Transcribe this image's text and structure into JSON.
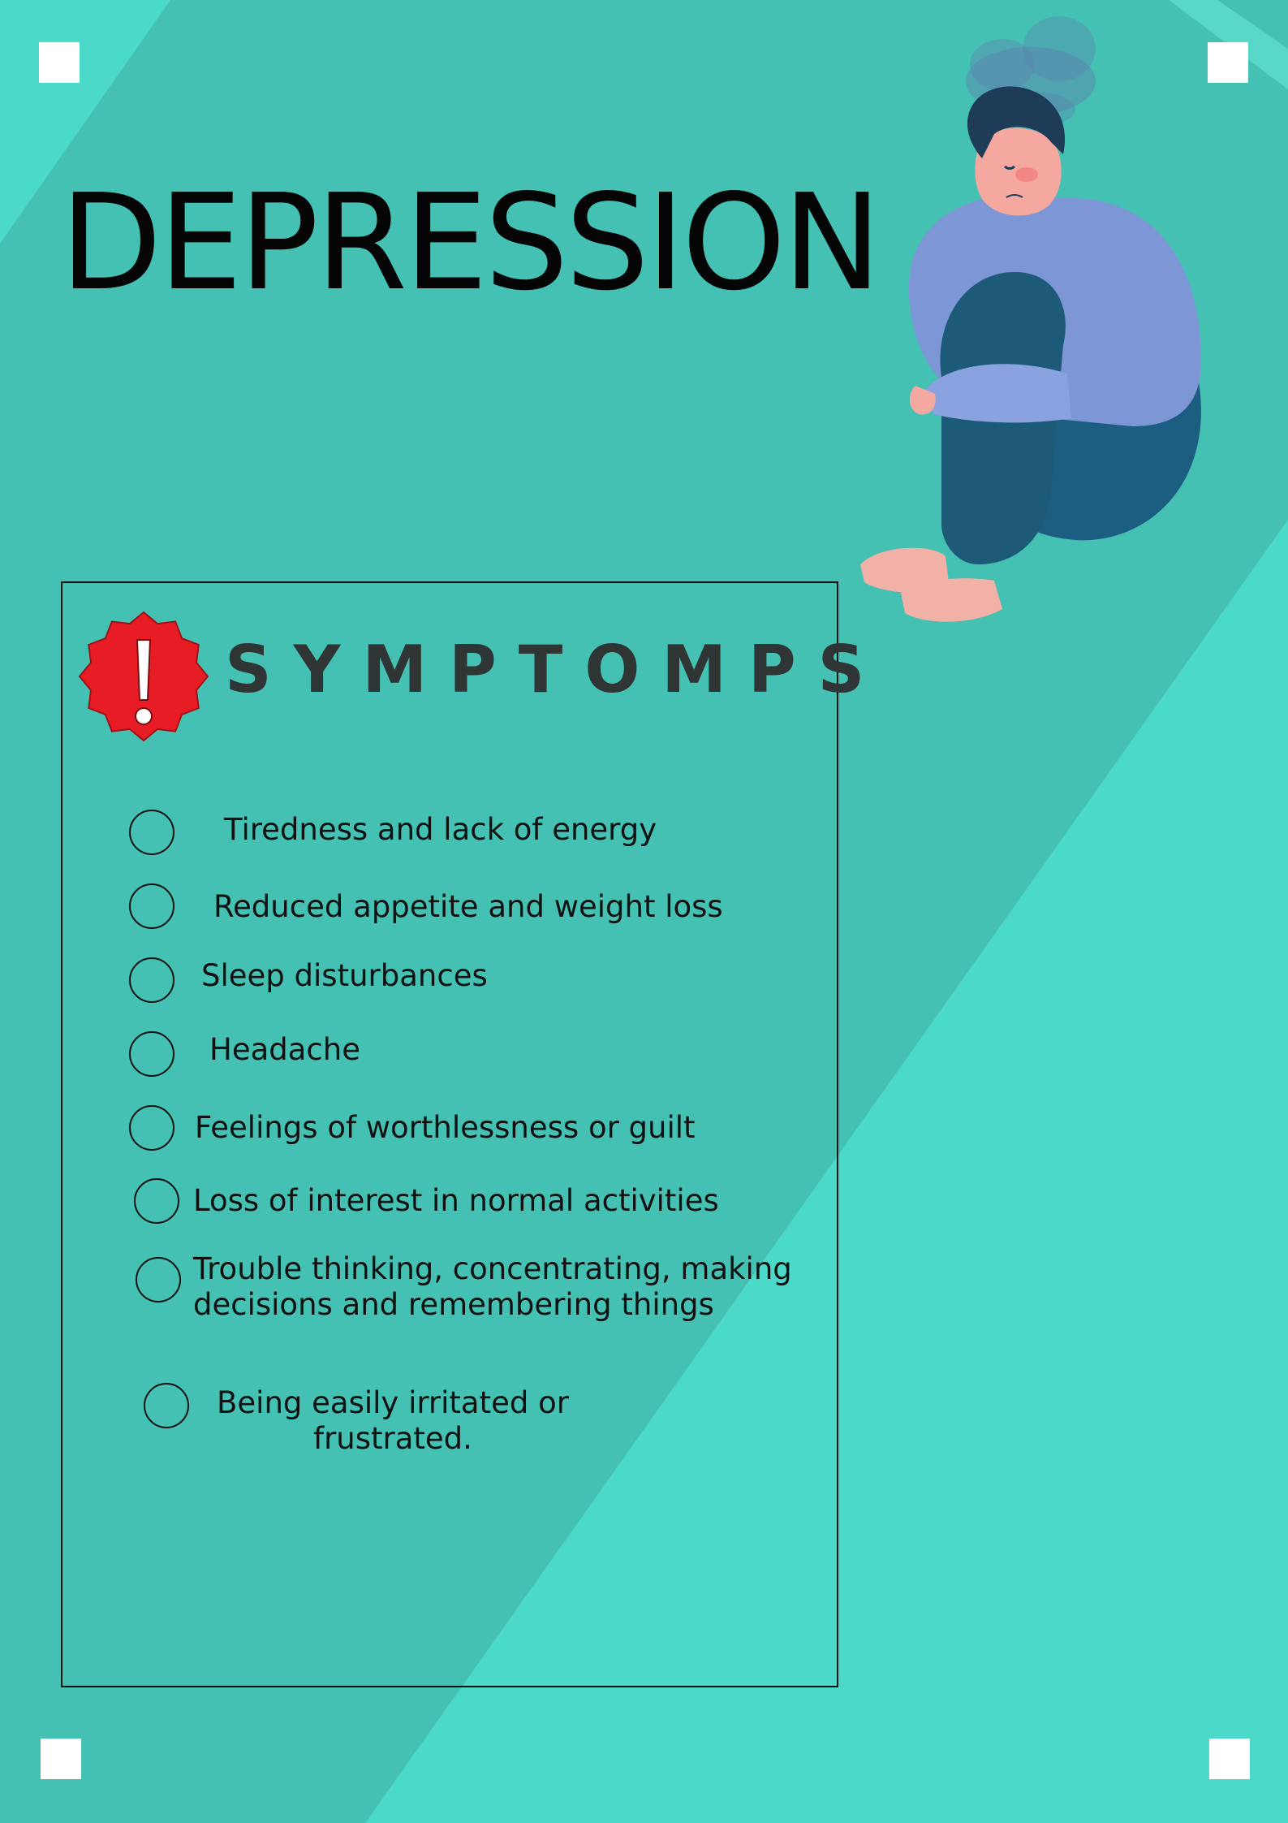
{
  "poster": {
    "title": "DEPRESSION",
    "symptoms_heading": "SYMPTOMPS",
    "symptoms": [
      "Tiredness and lack of energy",
      "Reduced appetite and weight loss",
      "Sleep disturbances",
      "Headache",
      "Feelings of worthlessness or guilt",
      "Loss of interest in normal activities",
      "Trouble thinking, concentrating, making\ndecisions and remembering things",
      "Being easily irritated or\nfrustrated."
    ]
  },
  "colors": {
    "background_light": "#4bd9ca",
    "background_dark": "#45c1b3",
    "badge_red": "#e81c24",
    "text_dark": "#111111",
    "heading_gray": "#2f3434"
  },
  "icons": {
    "badge": "exclamation-badge-icon",
    "bullet": "circle-outline-icon",
    "corner": "square-marker-icon"
  }
}
